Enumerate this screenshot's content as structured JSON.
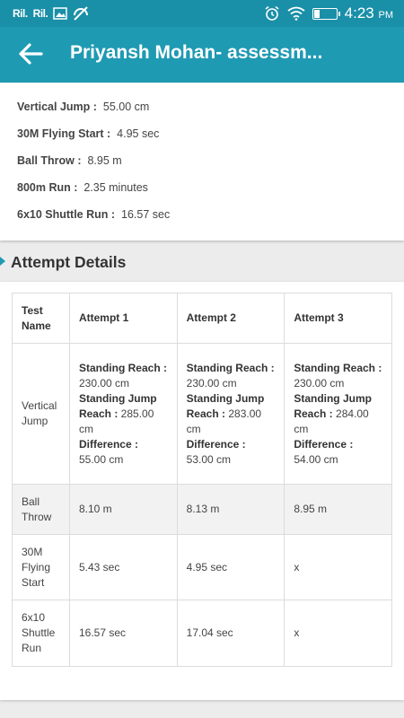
{
  "status_bar": {
    "signal1": "Ril.",
    "signal2": "Ril.",
    "time": "4:23",
    "ampm": "PM"
  },
  "app_bar": {
    "title": "Priyansh Mohan- assessm..."
  },
  "summary": [
    {
      "label": "Vertical Jump :",
      "value": "55.00 cm"
    },
    {
      "label": "30M Flying Start :",
      "value": "4.95 sec"
    },
    {
      "label": "Ball Throw :",
      "value": "8.95 m"
    },
    {
      "label": "800m Run :",
      "value": "2.35 minutes"
    },
    {
      "label": "6x10 Shuttle Run :",
      "value": "16.57 sec"
    }
  ],
  "section_title": "Attempt Details",
  "table": {
    "headers": [
      "Test Name",
      "Attempt 1",
      "Attempt 2",
      "Attempt 3"
    ],
    "vertical_jump": {
      "name": "Vertical Jump",
      "labels": {
        "reach": "Standing Reach :",
        "jump": "Standing Jump Reach :",
        "diff": "Difference :"
      },
      "attempts": [
        {
          "reach": "230.00 cm",
          "jump": "285.00 cm",
          "diff": "55.00 cm"
        },
        {
          "reach": "230.00 cm",
          "jump": "283.00 cm",
          "diff": "53.00 cm"
        },
        {
          "reach": "230.00 cm",
          "jump": "284.00 cm",
          "diff": "54.00 cm"
        }
      ]
    },
    "rows": [
      {
        "name": "Ball Throw",
        "values": [
          "8.10 m",
          "8.13 m",
          "8.95 m"
        ]
      },
      {
        "name": "30M Flying Start",
        "values": [
          "5.43 sec",
          "4.95 sec",
          "x"
        ]
      },
      {
        "name": "6x10 Shuttle Run",
        "values": [
          "16.57 sec",
          "17.04 sec",
          "x"
        ]
      }
    ]
  }
}
